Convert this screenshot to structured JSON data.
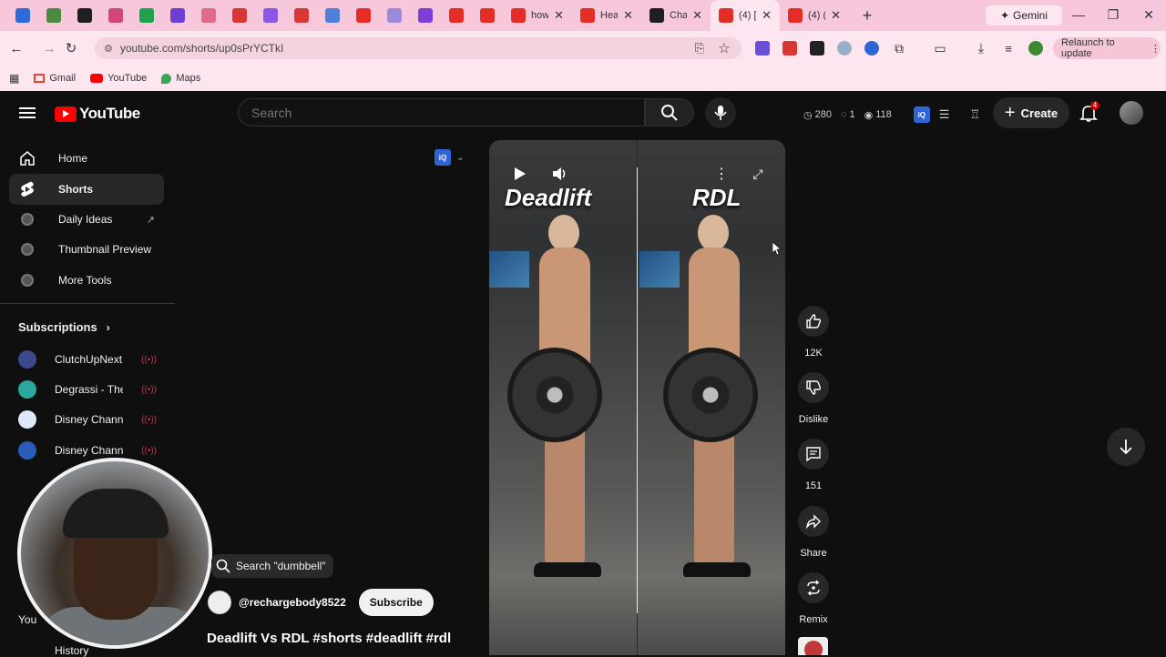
{
  "browser": {
    "tabs": [
      {
        "title": "",
        "color": "#2e6bd9"
      },
      {
        "title": "",
        "color": "#4c8a3f"
      },
      {
        "title": "",
        "color": "#1f1f1f"
      },
      {
        "title": "",
        "color": "#d2467a"
      },
      {
        "title": "",
        "color": "#1fa34a"
      },
      {
        "title": "",
        "color": "#6b3fd4"
      },
      {
        "title": "",
        "color": "#e06a8c"
      },
      {
        "title": "",
        "color": "#d93636"
      },
      {
        "title": "",
        "color": "#8a56e8"
      },
      {
        "title": "",
        "color": "#d93636"
      },
      {
        "title": "",
        "color": "#4f7fd8"
      },
      {
        "title": "",
        "color": "#e52d27"
      },
      {
        "title": "",
        "color": "#9a8ad8"
      },
      {
        "title": "",
        "color": "#7b3fd4"
      },
      {
        "title": "",
        "color": "#e52d27"
      },
      {
        "title": "",
        "color": "#e52d27"
      }
    ],
    "named_tabs": [
      {
        "title": "how",
        "color": "#e52d27"
      },
      {
        "title": "Hea",
        "color": "#e52d27"
      },
      {
        "title": "Cha",
        "color": "#1f1f1f"
      },
      {
        "title": "(4) [",
        "color": "#e52d27"
      },
      {
        "title": "(4) (",
        "color": "#e52d27"
      }
    ],
    "gemini_label": "Gemini",
    "url": "youtube.com/shorts/up0sPrYCTkI",
    "relaunch_label": "Relaunch to update",
    "bookmarks": [
      {
        "label": "Gmail",
        "color": "#ea4335"
      },
      {
        "label": "YouTube",
        "color": "#ff0000"
      },
      {
        "label": "Maps",
        "color": "#34a853"
      }
    ]
  },
  "header": {
    "logo_text": "YouTube",
    "search_placeholder": "Search",
    "stats": {
      "time": "280",
      "eye_slash": "1",
      "views": "118"
    },
    "create_label": "Create",
    "notification_count": "4"
  },
  "sidebar": {
    "items": [
      {
        "label": "Home",
        "icon": "home-icon"
      },
      {
        "label": "Shorts",
        "icon": "shorts-icon"
      },
      {
        "label": "Daily Ideas",
        "icon": "tool-icon"
      },
      {
        "label": "Thumbnail Preview",
        "icon": "tool-icon"
      },
      {
        "label": "More Tools",
        "icon": "tool-icon"
      }
    ],
    "subscriptions_title": "Subscriptions",
    "subscriptions": [
      {
        "name": "ClutchUpNext",
        "color": "#3a4a8c"
      },
      {
        "name": "Degrassi - The O...",
        "color": "#2aa8a0"
      },
      {
        "name": "Disney Channel",
        "color": "#dfe8f8"
      },
      {
        "name": "Disney Channel ...",
        "color": "#2a5bb8"
      }
    ],
    "you_label": "You",
    "history_label": "History"
  },
  "video": {
    "left_title": "Deadlift",
    "right_title": "RDL",
    "search_chip": "Search \"dumbbell\"",
    "channel_name": "@rechargebody8522",
    "subscribe_label": "Subscribe",
    "caption": "Deadlift Vs RDL #shorts #deadlift #rdl"
  },
  "actions": {
    "like_count": "12K",
    "dislike_label": "Dislike",
    "comment_count": "151",
    "share_label": "Share",
    "remix_label": "Remix"
  }
}
